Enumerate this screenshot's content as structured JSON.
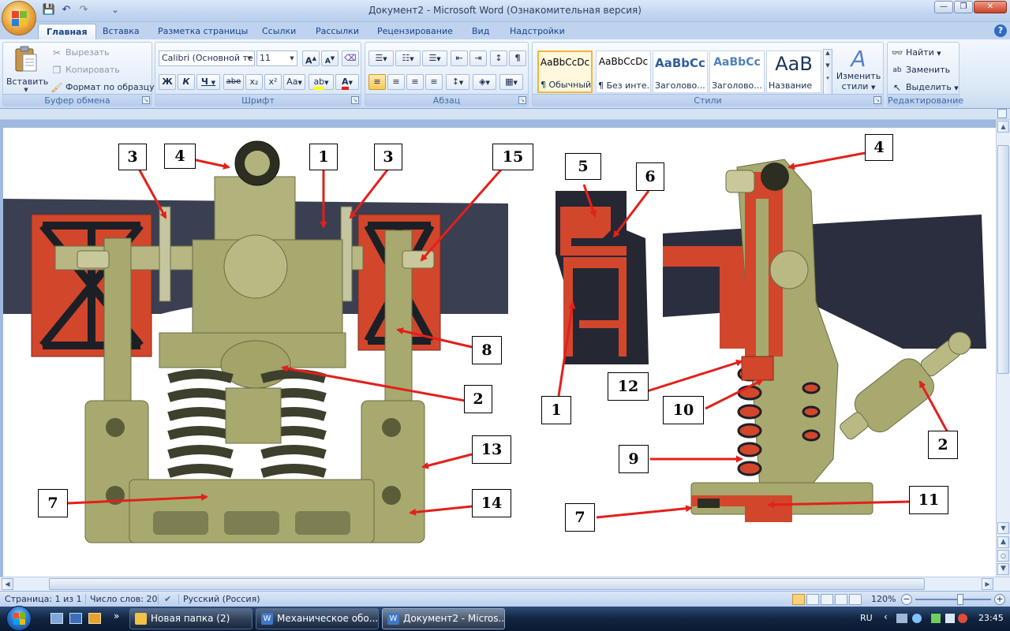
{
  "window": {
    "title": "Документ2 - Microsoft Word (Ознакомительная версия)",
    "controls": {
      "minimize": "—",
      "maximize": "❐",
      "close": "✕"
    }
  },
  "quick_access": {
    "save": "💾",
    "undo": "↶",
    "redo": "↷",
    "more": "⌄"
  },
  "tabs": [
    {
      "label": "Главная",
      "active": true
    },
    {
      "label": "Вставка"
    },
    {
      "label": "Разметка страницы"
    },
    {
      "label": "Ссылки"
    },
    {
      "label": "Рассылки"
    },
    {
      "label": "Рецензирование"
    },
    {
      "label": "Вид"
    },
    {
      "label": "Надстройки"
    }
  ],
  "help": "?",
  "ribbon": {
    "clipboard": {
      "label": "Буфер обмена",
      "paste": "Вставить",
      "cut": "Вырезать",
      "copy": "Копировать",
      "format_painter": "Формат по образцу"
    },
    "font": {
      "label": "Шрифт",
      "font_name": "Calibri (Основной те",
      "font_size": "11",
      "grow": "A",
      "shrink": "A",
      "clear": "⌫",
      "bold": "Ж",
      "italic": "К",
      "underline": "Ч",
      "strike": "abe",
      "subscript": "x₂",
      "superscript": "x²",
      "case": "Aa",
      "highlight": "ab",
      "font_color": "A"
    },
    "paragraph": {
      "label": "Абзац",
      "bullets": "☰",
      "numbering": "☷",
      "multilevel": "☰",
      "dec_indent": "⇤",
      "inc_indent": "⇥",
      "sort": "↕",
      "pilcrow": "¶",
      "align_left": "≡",
      "align_center": "≡",
      "align_right": "≡",
      "justify": "≡",
      "line_spacing": "↕",
      "shading": "◈",
      "borders": "▦"
    },
    "styles": {
      "label": "Стили",
      "items": [
        {
          "sample": "AaBbCcDc",
          "name": "¶ Обычный",
          "selected": true
        },
        {
          "sample": "AaBbCcDc",
          "name": "¶ Без инте..."
        },
        {
          "sample": "AaBbCc",
          "name": "Заголово..."
        },
        {
          "sample": "AaBbCc",
          "name": "Заголово..."
        },
        {
          "sample": "AaB",
          "name": "Название"
        }
      ],
      "change_styles_line1": "Изменить",
      "change_styles_line2": "стили"
    },
    "editing": {
      "label": "Редактирование",
      "find": "Найти",
      "replace": "Заменить",
      "select": "Выделить"
    }
  },
  "diagram": {
    "labels_left": [
      {
        "text": "3"
      },
      {
        "text": "4"
      },
      {
        "text": "1"
      },
      {
        "text": "3"
      },
      {
        "text": "15"
      },
      {
        "text": "8"
      },
      {
        "text": "2"
      },
      {
        "text": "13"
      },
      {
        "text": "7"
      },
      {
        "text": "14"
      }
    ],
    "labels_mid": [
      {
        "text": "5"
      },
      {
        "text": "6"
      },
      {
        "text": "1"
      }
    ],
    "labels_right": [
      {
        "text": "4"
      },
      {
        "text": "12"
      },
      {
        "text": "10"
      },
      {
        "text": "9"
      },
      {
        "text": "2"
      },
      {
        "text": "7"
      },
      {
        "text": "11"
      }
    ],
    "colors": {
      "frame": "#3a3f52",
      "section": "#d2462c",
      "part": "#a8a96e",
      "spring": "#3e3f2c",
      "arrow": "#e3201b"
    }
  },
  "statusbar": {
    "page": "Страница: 1 из 1",
    "words": "Число слов: 20",
    "language": "Русский (Россия)",
    "zoom": "120%",
    "zoom_out": "−",
    "zoom_in": "+",
    "zoom_level": 0.6
  },
  "taskbar": {
    "tasks": [
      {
        "label": "Новая папка (2)",
        "color": "#f0c24a"
      },
      {
        "label": "Механическое обо...",
        "color": "#3f77c9"
      },
      {
        "label": "Документ2 - Micros...",
        "color": "#3f77c9",
        "active": true
      }
    ],
    "more": "»",
    "lang": "RU",
    "clock": "23:45",
    "tray_chevron": "‹"
  }
}
